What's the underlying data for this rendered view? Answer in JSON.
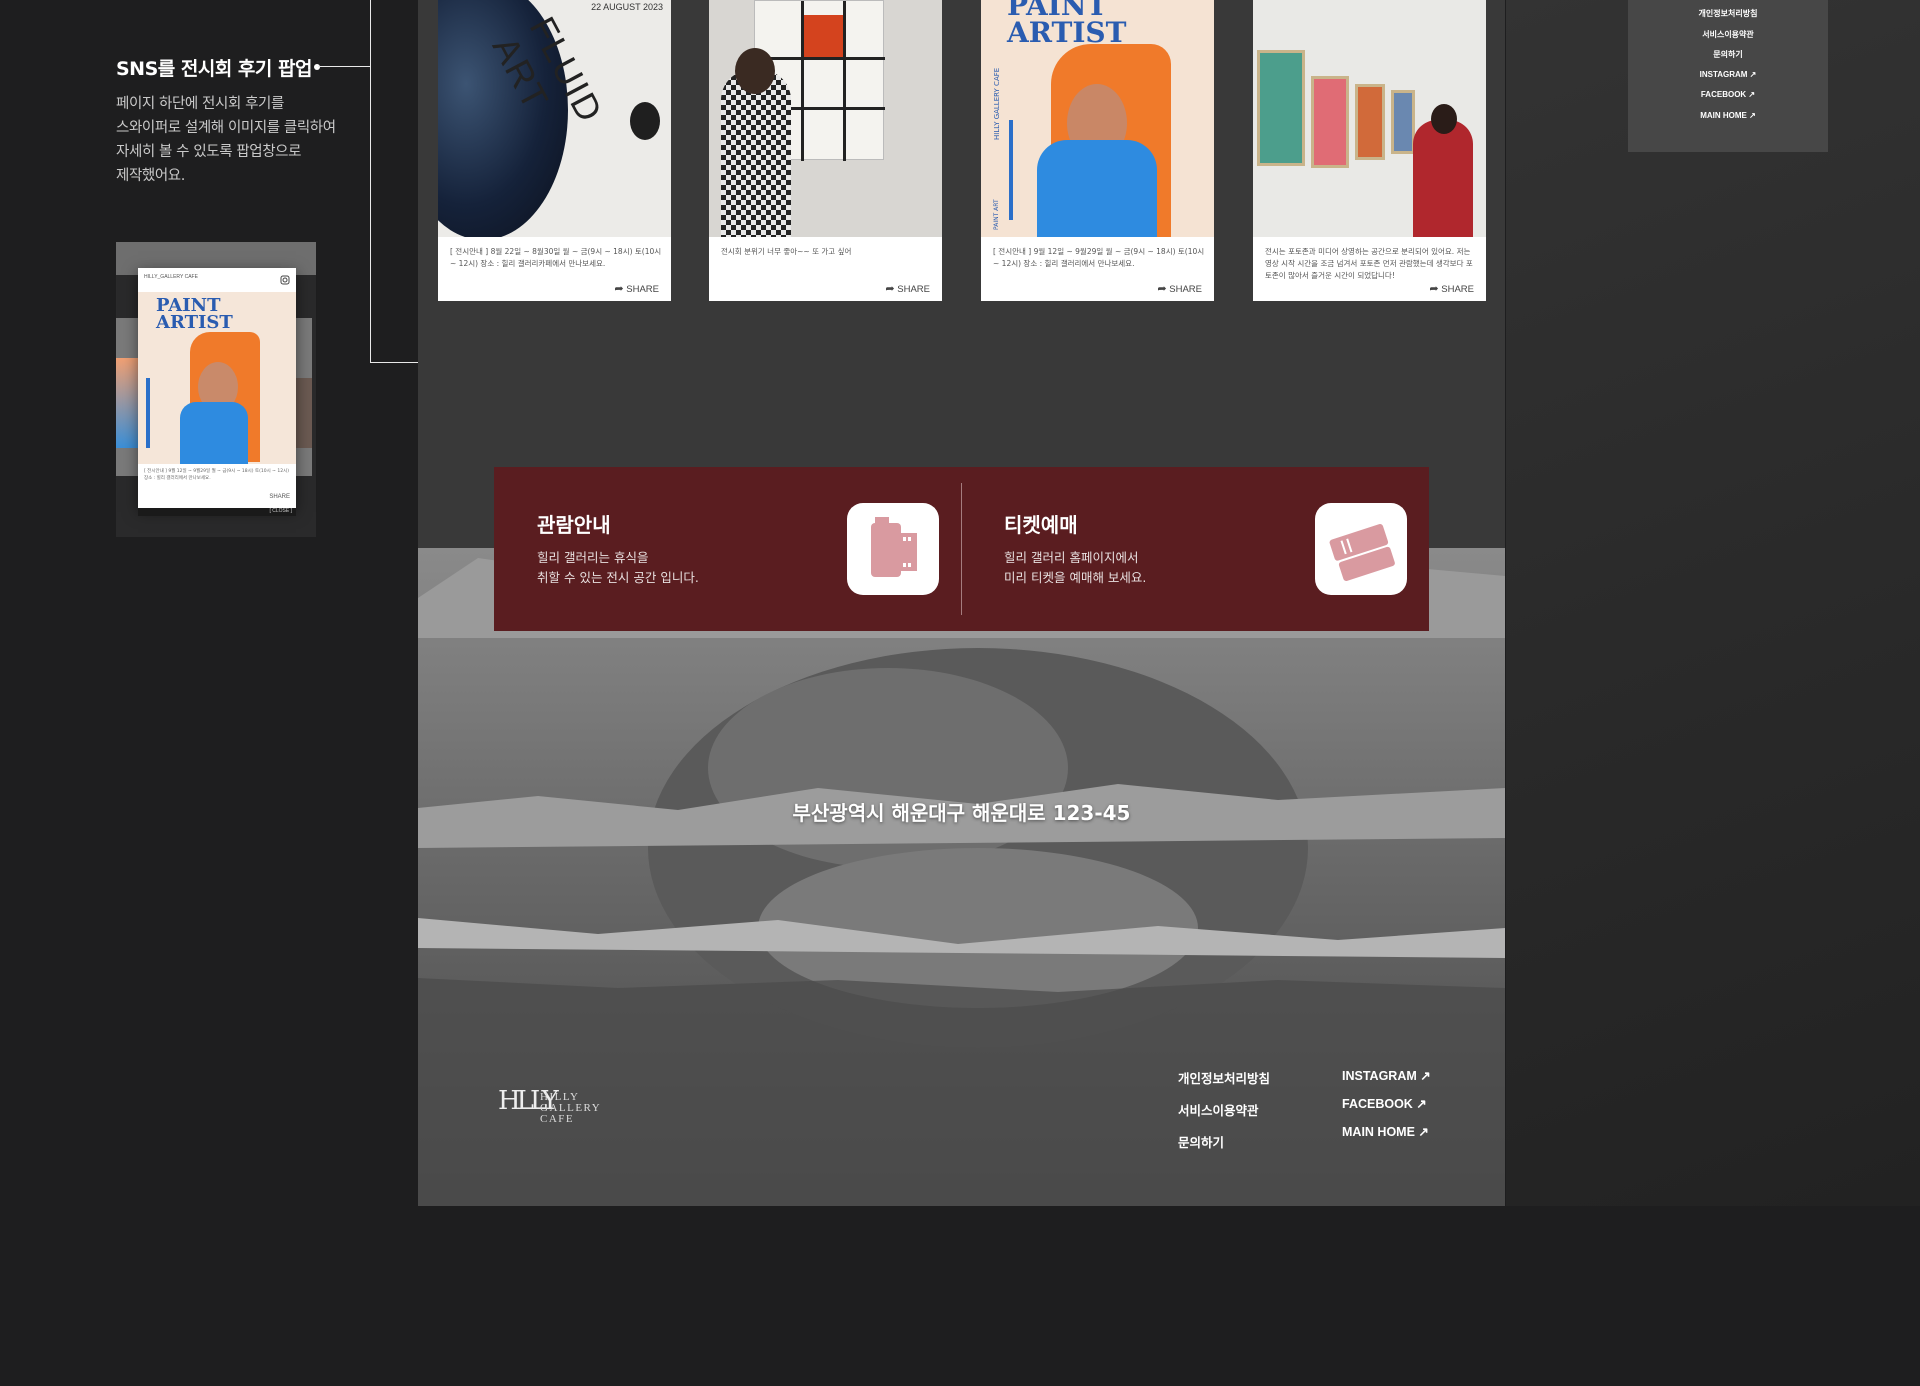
{
  "annotation": {
    "title": "SNS를 전시회 후기 팝업",
    "desc_lines": [
      "페이지 하단에 전시회 후기를",
      "스와이퍼로 설계해 이미지를 클릭하여",
      "자세히 볼 수 있도록 팝업창으로",
      "제작했어요."
    ]
  },
  "popup_preview": {
    "brand": "HILLY_GALLERY CAFE",
    "poster_title_1": "PAINT",
    "poster_title_2": "ARTIST",
    "side_text": "HILLY GALLERY CAFE",
    "caption": "[ 전시안내 ] 9월 12일 ~ 9월29일 월 ~ 금(9시 ~ 18시) 토(10시 ~ 12시) 장소 : 힐리 갤러리에서 만나보세요.",
    "share": "SHARE",
    "close": "[ CLOSE ]"
  },
  "cards": [
    {
      "date": "22 AUGUST 2023",
      "poster_text": "FLUID ART",
      "caption": "[ 전시안내 ] 8월 22일 ~ 8월30일 월 ~ 금(9시 ~ 18시) 토(10시 ~ 12시) 장소 : 힐리 갤러리카페에서 만나보세요.",
      "share": "SHARE"
    },
    {
      "caption": "전시회 분위기 너무 좋아~~ 또 가고 싶어",
      "share": "SHARE"
    },
    {
      "poster_title_1": "PAINT",
      "poster_title_2": "ARTIST",
      "side_text": "HILLY GALLERY CAFE",
      "side_text_2": "PAINT ART",
      "caption": "[ 전시안내 ] 9월 12일 ~ 9월29일 월 ~ 금(9시 ~ 18시) 토(10시 ~ 12시) 장소 : 힐리 갤러리에서 만나보세요.",
      "share": "SHARE"
    },
    {
      "caption": "전시는 포토존과 미디어 상영하는 공간으로 분리되어 있어요. 저는 영상 시작 시간을 조금 넘겨서 포토존 먼저 관람했는데 생각보다 포토존이 많아서 즐거운 시간이 되었답니다!",
      "share": "SHARE"
    }
  ],
  "info": {
    "left": {
      "title": "관람안내",
      "line1": "힐리 갤러리는 휴식을",
      "line2": "취할 수 있는 전시 공간 입니다."
    },
    "right": {
      "title": "티켓예매",
      "line1": "힐리 갤러리 홈페이지에서",
      "line2": "미리 티켓을 예매해 보세요."
    }
  },
  "address": "부산광역시 해운대구 해운대로 123-45",
  "logo": {
    "mark": "HLLY",
    "line1": "HILLY",
    "line2": "GALLERY",
    "line3": "CAFE"
  },
  "footer_links": {
    "col1": [
      "개인정보처리방침",
      "서비스이용약관",
      "문의하기"
    ],
    "col2": [
      "INSTAGRAM ↗",
      "FACEBOOK ↗",
      "MAIN HOME ↗"
    ]
  },
  "right_sidebar": {
    "links": [
      "개인정보처리방침",
      "서비스이용약관",
      "문의하기",
      "INSTAGRAM ↗",
      "FACEBOOK ↗",
      "MAIN HOME ↗"
    ]
  },
  "colors": {
    "page_bg": "#1e1e1f",
    "panel_bg": "#393939",
    "info_bg": "#5a1d20",
    "accent_blue": "#2e8be0",
    "accent_orange": "#f07a2a"
  }
}
